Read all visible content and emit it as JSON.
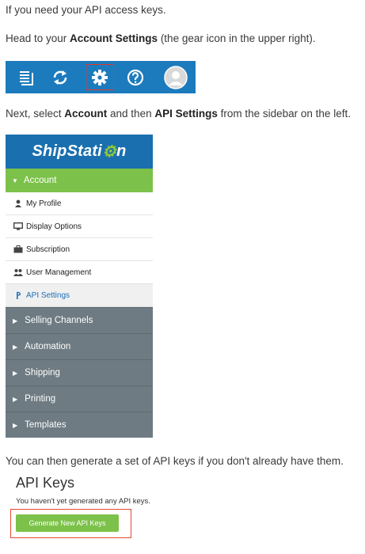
{
  "intro": "If you need your API access keys.",
  "step1": {
    "before": "Head to your ",
    "bold": "Account Settings",
    "after": " (the gear icon in the upper right)."
  },
  "toolbar": {
    "icons": [
      "list-icon",
      "refresh-icon",
      "gear-icon",
      "help-icon",
      "avatar-icon"
    ],
    "accent": "#1c7bbd",
    "highlight": "#e03a2d"
  },
  "step2": {
    "before": "Next, select ",
    "bold1": "Account",
    "mid": " and then ",
    "bold2": "API Settings",
    "after": " from the sidebar on the left."
  },
  "sidebar": {
    "logo": "ShipStati",
    "logo_gear": "⚙",
    "logo_end": "n",
    "account": "Account",
    "sub_items": [
      {
        "label": "My Profile",
        "icon": "user-icon"
      },
      {
        "label": "Display Options",
        "icon": "monitor-icon"
      },
      {
        "label": "Subscription",
        "icon": "briefcase-icon"
      },
      {
        "label": "User Management",
        "icon": "users-icon"
      },
      {
        "label": "API Settings",
        "icon": "key-icon"
      }
    ],
    "sections": [
      "Selling Channels",
      "Automation",
      "Shipping",
      "Printing",
      "Templates"
    ],
    "colors": {
      "header": "#1a6fae",
      "account": "#7cc24a",
      "section": "#6e7b82"
    }
  },
  "step3": "You can then generate a set of API keys if you don't already have them.",
  "api": {
    "title": "API Keys",
    "note": "You haven't yet generated any API keys.",
    "button": "Generate New API Keys",
    "button_color": "#7cc24a",
    "highlight": "#e54832"
  }
}
